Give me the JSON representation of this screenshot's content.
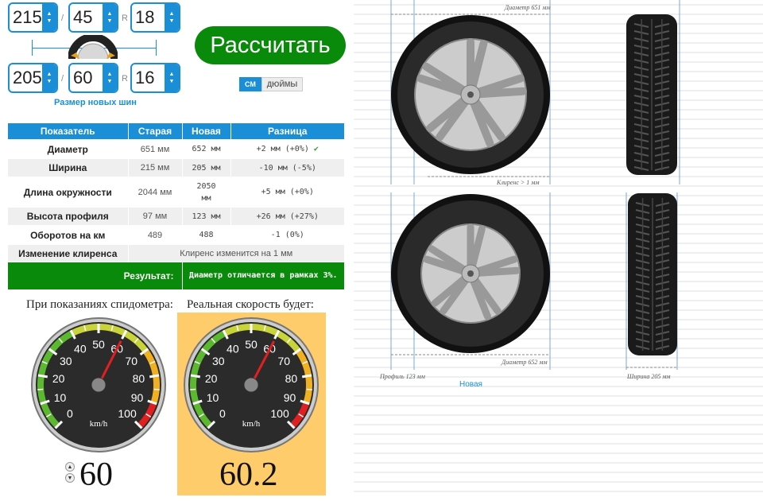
{
  "old_size": {
    "width": "215",
    "profile": "45",
    "radius": "18"
  },
  "new_size": {
    "width": "205",
    "profile": "60",
    "radius": "16"
  },
  "separators": {
    "slash": "/",
    "r": "R"
  },
  "new_size_label": "Размер новых шин",
  "calc_button": "Рассчитать",
  "units": {
    "cm": "СМ",
    "inches": "ДЮЙМЫ"
  },
  "table": {
    "headers": [
      "Показатель",
      "Старая",
      "Новая",
      "Разница"
    ],
    "rows": [
      {
        "name": "Диаметр",
        "old": "651 мм",
        "new": "652 мм",
        "diff": "+2 мм (+0%)"
      },
      {
        "name": "Ширина",
        "old": "215 мм",
        "new": "205 мм",
        "diff": "-10 мм (-5%)"
      },
      {
        "name": "Длина окружности",
        "old": "2044 мм",
        "new": "2050 мм",
        "diff": "+5 мм (+0%)"
      },
      {
        "name": "Высота профиля",
        "old": "97 мм",
        "new": "123 мм",
        "diff": "+26 мм (+27%)"
      },
      {
        "name": "Оборотов на км",
        "old": "489",
        "new": "488",
        "diff": "-1 (0%)"
      }
    ],
    "clearance_label": "Изменение клиренса",
    "clearance_value": "Клиренс изменится на 1 мм",
    "result_label": "Результат:",
    "result_value": "Диаметр отличается в рамках 3%."
  },
  "speedometer": {
    "shown_label": "При показаниях спидометра:",
    "real_label": "Реальная скорость будет:",
    "shown_value": "60",
    "real_value": "60.2",
    "unit": "km/h",
    "ticks": [
      "0",
      "10",
      "20",
      "30",
      "40",
      "50",
      "60",
      "70",
      "80",
      "90",
      "100"
    ],
    "shown_speed": 60,
    "real_speed": 60.2,
    "max": 100
  },
  "drawing": {
    "diameter_old": "Диаметр 651 мм",
    "clearance": "Клиренс > 1 мм",
    "diameter_new": "Диаметр 652 мм",
    "profile": "Профиль 123 мм",
    "width": "Ширина 205 мм",
    "new_caption": "Новая"
  },
  "colors": {
    "accent": "#1a8fd8",
    "green": "#0a8a0a",
    "highlight": "#ffcc6b"
  }
}
